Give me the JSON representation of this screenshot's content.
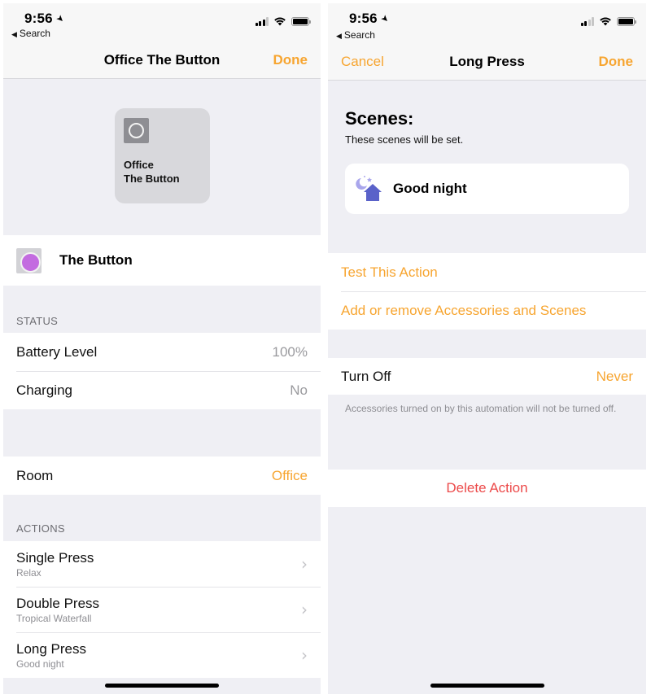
{
  "left_screen": {
    "status_bar": {
      "time": "9:56",
      "back_label": "Search"
    },
    "nav": {
      "title": "Office The Button",
      "done_label": "Done"
    },
    "tile": {
      "line1": "Office",
      "line2": "The Button"
    },
    "device": {
      "name": "The Button",
      "icon_color": "#c36be0"
    },
    "status_section": {
      "header": "STATUS",
      "rows": [
        {
          "label": "Battery Level",
          "value": "100%"
        },
        {
          "label": "Charging",
          "value": "No"
        }
      ]
    },
    "room": {
      "label": "Room",
      "value": "Office"
    },
    "actions_section": {
      "header": "ACTIONS",
      "items": [
        {
          "title": "Single Press",
          "subtitle": "Relax"
        },
        {
          "title": "Double Press",
          "subtitle": "Tropical Waterfall"
        },
        {
          "title": "Long Press",
          "subtitle": "Good night"
        }
      ]
    }
  },
  "right_screen": {
    "status_bar": {
      "time": "9:56",
      "back_label": "Search"
    },
    "nav": {
      "cancel_label": "Cancel",
      "title": "Long Press",
      "done_label": "Done"
    },
    "scenes": {
      "title": "Scenes:",
      "subtitle": "These scenes will be set.",
      "items": [
        {
          "name": "Good night",
          "icon": "good-night-scene-icon"
        }
      ]
    },
    "links": {
      "test": "Test This Action",
      "add_remove": "Add or remove Accessories and Scenes"
    },
    "turn_off": {
      "label": "Turn Off",
      "value": "Never",
      "footer": "Accessories turned on by this automation will not be turned off."
    },
    "delete_label": "Delete Action"
  },
  "colors": {
    "accent": "#f7a530",
    "destructive": "#ec4a4a",
    "background": "#efeff4"
  }
}
